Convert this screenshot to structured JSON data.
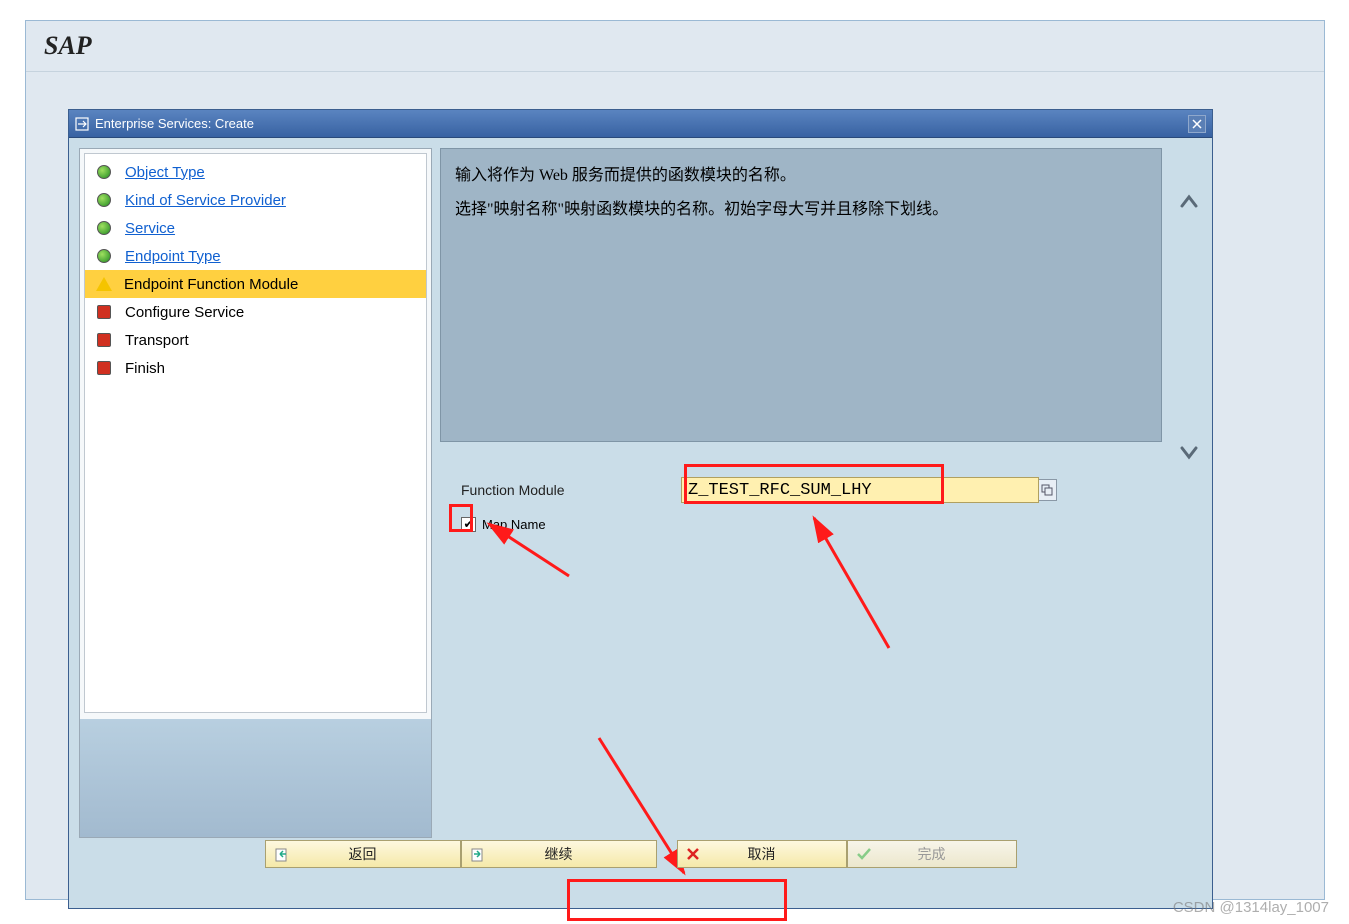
{
  "app": {
    "logo": "SAP"
  },
  "dialog": {
    "title": "Enterprise Services: Create"
  },
  "nav": {
    "items": [
      {
        "label": "Object Type",
        "state": "done",
        "link": true
      },
      {
        "label": "Kind of Service Provider",
        "state": "done",
        "link": true
      },
      {
        "label": "Service",
        "state": "done",
        "link": true
      },
      {
        "label": "Endpoint Type",
        "state": "done",
        "link": true
      },
      {
        "label": "Endpoint Function Module",
        "state": "current",
        "link": false
      },
      {
        "label": "Configure Service",
        "state": "todo",
        "link": false
      },
      {
        "label": "Transport",
        "state": "todo",
        "link": false
      },
      {
        "label": "Finish",
        "state": "todo",
        "link": false
      }
    ]
  },
  "desc": {
    "line1": "输入将作为 Web 服务而提供的函数模块的名称。",
    "line2": "选择\"映射名称\"映射函数模块的名称。初始字母大写并且移除下划线。"
  },
  "form": {
    "function_module_label": "Function Module",
    "function_module_value": "Z_TEST_RFC_SUM_LHY",
    "map_name_label": "Map Name",
    "map_name_checked": true
  },
  "footer": {
    "back": "返回",
    "continue": "继续",
    "cancel": "取消",
    "finish": "完成"
  },
  "watermark": "CSDN @1314lay_1007"
}
